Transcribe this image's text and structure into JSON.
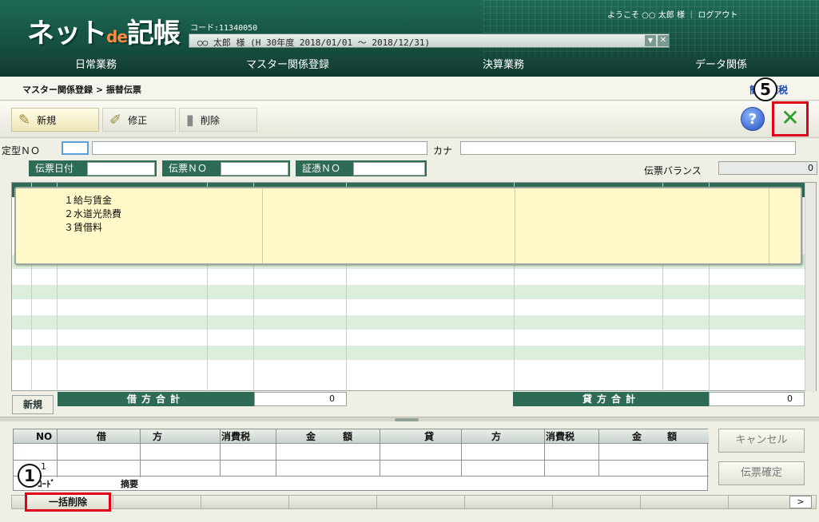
{
  "header": {
    "logo_main": "ネット",
    "logo_de": "de",
    "logo_tail": "記帳",
    "code_label": "コード:11340050",
    "company": "○○ 太郎 様 (H 30年度 2018/01/01 ～ 2018/12/31)",
    "welcome": "ようこそ ○○ 太郎 様 ｜ ログアウト"
  },
  "menu": [
    "日常業務",
    "マスター関係登録",
    "決算業務",
    "データ関係"
  ],
  "breadcrumb": "マスター関係登録 > 振替伝票",
  "breadcrumb_right": "簡易課税",
  "toolbar": {
    "new": "新規",
    "edit": "修正",
    "delete": "削除",
    "help": "?",
    "close": "✕"
  },
  "form": {
    "template_no": "定型ＮＯ",
    "kana": "カナ",
    "voucher_date": "伝票日付",
    "voucher_no": "伝票ＮＯ",
    "proof_no": "証憑ＮＯ",
    "balance_label": "伝票バランス",
    "balance_value": "0"
  },
  "popup_items": [
    "１給与賃金",
    "２水道光熱費",
    "３賃借料"
  ],
  "totals": {
    "new_button": "新規",
    "debit_label": "借方合計",
    "debit_value": "0",
    "credit_label": "貸方合計",
    "credit_value": "0"
  },
  "entry_head": [
    "NO",
    "借",
    "方",
    "消費税",
    "金",
    "額",
    "貸",
    "方",
    "消費税",
    "金",
    "額"
  ],
  "entry_row": {
    "no": "1",
    "code_label": "ｺｰﾄﾞ",
    "memo_label": "摘要"
  },
  "side_buttons": {
    "cancel": "キャンセル",
    "confirm": "伝票確定"
  },
  "status": {
    "bulk_delete": "一括削除",
    "next": ">"
  },
  "callouts": {
    "c1": "1",
    "c5": "5"
  },
  "colors": {
    "brand_green": "#1f6a55",
    "highlight_red": "#e0001a",
    "popup_yellow": "#fff8c8"
  }
}
